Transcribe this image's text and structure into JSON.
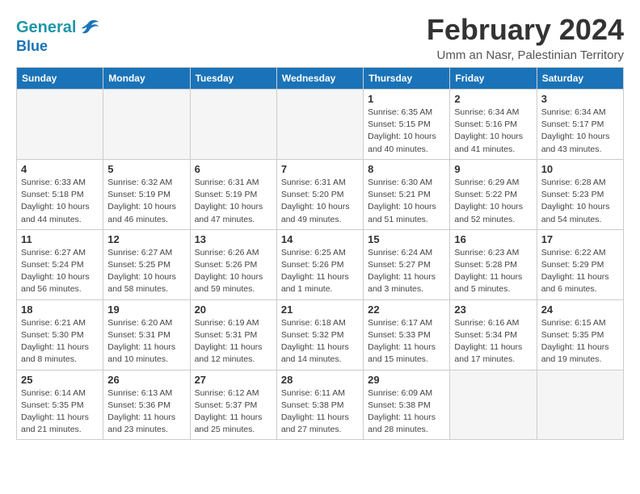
{
  "header": {
    "logo_line1": "General",
    "logo_line2": "Blue",
    "month": "February 2024",
    "location": "Umm an Nasr, Palestinian Territory"
  },
  "weekdays": [
    "Sunday",
    "Monday",
    "Tuesday",
    "Wednesday",
    "Thursday",
    "Friday",
    "Saturday"
  ],
  "weeks": [
    [
      {
        "day": "",
        "info": ""
      },
      {
        "day": "",
        "info": ""
      },
      {
        "day": "",
        "info": ""
      },
      {
        "day": "",
        "info": ""
      },
      {
        "day": "1",
        "info": "Sunrise: 6:35 AM\nSunset: 5:15 PM\nDaylight: 10 hours\nand 40 minutes."
      },
      {
        "day": "2",
        "info": "Sunrise: 6:34 AM\nSunset: 5:16 PM\nDaylight: 10 hours\nand 41 minutes."
      },
      {
        "day": "3",
        "info": "Sunrise: 6:34 AM\nSunset: 5:17 PM\nDaylight: 10 hours\nand 43 minutes."
      }
    ],
    [
      {
        "day": "4",
        "info": "Sunrise: 6:33 AM\nSunset: 5:18 PM\nDaylight: 10 hours\nand 44 minutes."
      },
      {
        "day": "5",
        "info": "Sunrise: 6:32 AM\nSunset: 5:19 PM\nDaylight: 10 hours\nand 46 minutes."
      },
      {
        "day": "6",
        "info": "Sunrise: 6:31 AM\nSunset: 5:19 PM\nDaylight: 10 hours\nand 47 minutes."
      },
      {
        "day": "7",
        "info": "Sunrise: 6:31 AM\nSunset: 5:20 PM\nDaylight: 10 hours\nand 49 minutes."
      },
      {
        "day": "8",
        "info": "Sunrise: 6:30 AM\nSunset: 5:21 PM\nDaylight: 10 hours\nand 51 minutes."
      },
      {
        "day": "9",
        "info": "Sunrise: 6:29 AM\nSunset: 5:22 PM\nDaylight: 10 hours\nand 52 minutes."
      },
      {
        "day": "10",
        "info": "Sunrise: 6:28 AM\nSunset: 5:23 PM\nDaylight: 10 hours\nand 54 minutes."
      }
    ],
    [
      {
        "day": "11",
        "info": "Sunrise: 6:27 AM\nSunset: 5:24 PM\nDaylight: 10 hours\nand 56 minutes."
      },
      {
        "day": "12",
        "info": "Sunrise: 6:27 AM\nSunset: 5:25 PM\nDaylight: 10 hours\nand 58 minutes."
      },
      {
        "day": "13",
        "info": "Sunrise: 6:26 AM\nSunset: 5:26 PM\nDaylight: 10 hours\nand 59 minutes."
      },
      {
        "day": "14",
        "info": "Sunrise: 6:25 AM\nSunset: 5:26 PM\nDaylight: 11 hours\nand 1 minute."
      },
      {
        "day": "15",
        "info": "Sunrise: 6:24 AM\nSunset: 5:27 PM\nDaylight: 11 hours\nand 3 minutes."
      },
      {
        "day": "16",
        "info": "Sunrise: 6:23 AM\nSunset: 5:28 PM\nDaylight: 11 hours\nand 5 minutes."
      },
      {
        "day": "17",
        "info": "Sunrise: 6:22 AM\nSunset: 5:29 PM\nDaylight: 11 hours\nand 6 minutes."
      }
    ],
    [
      {
        "day": "18",
        "info": "Sunrise: 6:21 AM\nSunset: 5:30 PM\nDaylight: 11 hours\nand 8 minutes."
      },
      {
        "day": "19",
        "info": "Sunrise: 6:20 AM\nSunset: 5:31 PM\nDaylight: 11 hours\nand 10 minutes."
      },
      {
        "day": "20",
        "info": "Sunrise: 6:19 AM\nSunset: 5:31 PM\nDaylight: 11 hours\nand 12 minutes."
      },
      {
        "day": "21",
        "info": "Sunrise: 6:18 AM\nSunset: 5:32 PM\nDaylight: 11 hours\nand 14 minutes."
      },
      {
        "day": "22",
        "info": "Sunrise: 6:17 AM\nSunset: 5:33 PM\nDaylight: 11 hours\nand 15 minutes."
      },
      {
        "day": "23",
        "info": "Sunrise: 6:16 AM\nSunset: 5:34 PM\nDaylight: 11 hours\nand 17 minutes."
      },
      {
        "day": "24",
        "info": "Sunrise: 6:15 AM\nSunset: 5:35 PM\nDaylight: 11 hours\nand 19 minutes."
      }
    ],
    [
      {
        "day": "25",
        "info": "Sunrise: 6:14 AM\nSunset: 5:35 PM\nDaylight: 11 hours\nand 21 minutes."
      },
      {
        "day": "26",
        "info": "Sunrise: 6:13 AM\nSunset: 5:36 PM\nDaylight: 11 hours\nand 23 minutes."
      },
      {
        "day": "27",
        "info": "Sunrise: 6:12 AM\nSunset: 5:37 PM\nDaylight: 11 hours\nand 25 minutes."
      },
      {
        "day": "28",
        "info": "Sunrise: 6:11 AM\nSunset: 5:38 PM\nDaylight: 11 hours\nand 27 minutes."
      },
      {
        "day": "29",
        "info": "Sunrise: 6:09 AM\nSunset: 5:38 PM\nDaylight: 11 hours\nand 28 minutes."
      },
      {
        "day": "",
        "info": ""
      },
      {
        "day": "",
        "info": ""
      }
    ]
  ]
}
